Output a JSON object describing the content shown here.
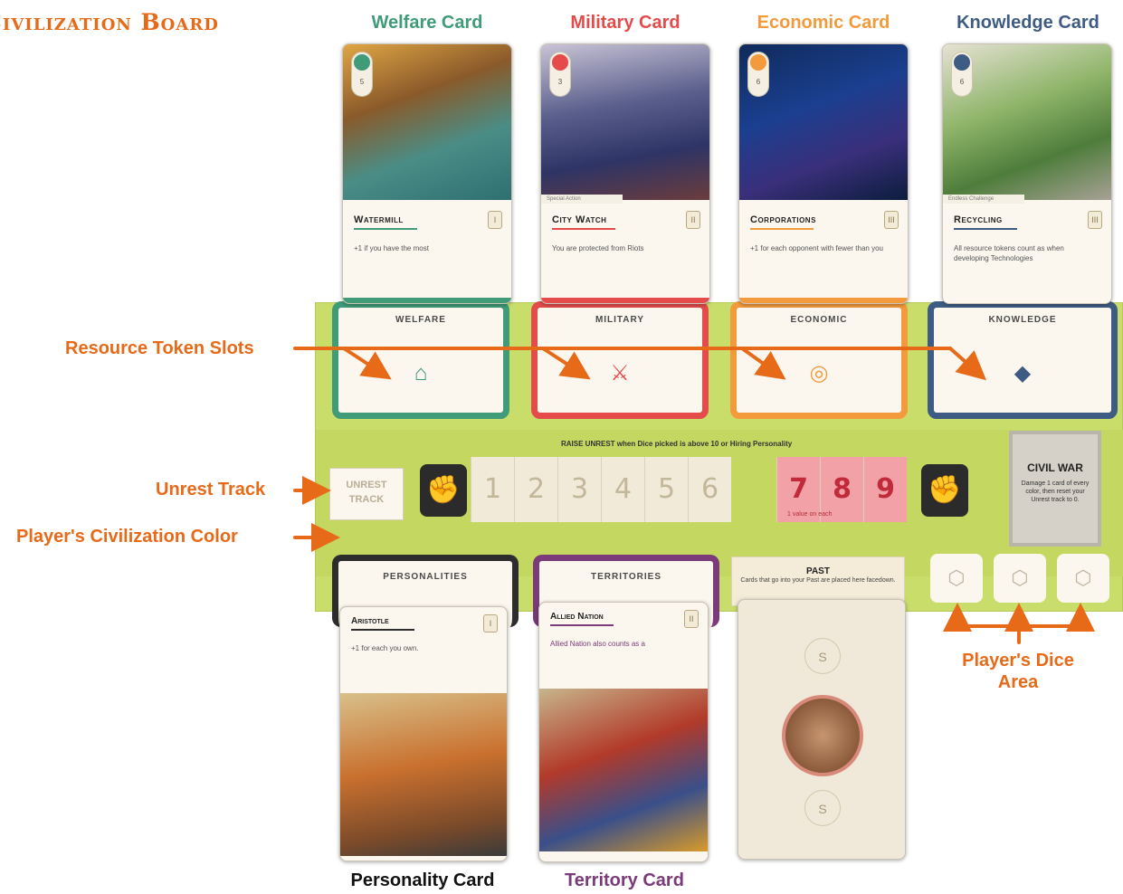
{
  "colors": {
    "welfare": "#3f9b78",
    "military": "#e54b4b",
    "economic": "#f39a3d",
    "knowledge": "#3e5c83",
    "callout": "#e76a19",
    "board": "#c9dd6b",
    "personality": "#2d2d2d",
    "territory": "#7b3a7a"
  },
  "title": "Civilization Board",
  "top_labels": {
    "welfare": "Welfare Card",
    "military": "Military Card",
    "economic": "Economic Card",
    "knowledge": "Knowledge Card"
  },
  "top_cards": [
    {
      "name": "Watermill",
      "roman": "I",
      "cost": "5",
      "text": "+1 if you have the most",
      "icon": "leaf-icon"
    },
    {
      "name": "City Watch",
      "roman": "II",
      "cost": "3",
      "text": "You are protected from Riots",
      "tag": "Special Action",
      "icon": "sword-icon"
    },
    {
      "name": "Corporations",
      "roman": "III",
      "cost": "6",
      "text": "+1 for each opponent with fewer than you",
      "icon": "coins-icon"
    },
    {
      "name": "Recycling",
      "roman": "III",
      "cost": "6",
      "text": "All resource tokens count as when developing Technologies",
      "tag": "Endless Challenge",
      "icon": "book-icon"
    }
  ],
  "board_columns": {
    "welfare": "WELFARE",
    "military": "MILITARY",
    "economic": "ECONOMIC",
    "knowledge": "KNOWLEDGE"
  },
  "raise_unrest": "RAISE UNREST when Dice picked is above 10 or Hiring Personality",
  "unrest_track_label": "UNREST TRACK",
  "track_numbers": [
    "1",
    "2",
    "3",
    "4",
    "5",
    "6",
    "7",
    "8",
    "9"
  ],
  "hot_note": "1 value on each",
  "civil_war": {
    "title": "CIVIL WAR",
    "text": "Damage 1 card of every color, then reset your Unrest track to 0."
  },
  "bottom_columns": {
    "personalities": "PERSONALITIES",
    "territories": "TERRITORIES"
  },
  "past": {
    "title": "PAST",
    "text": "Cards that go into your Past are placed here facedown."
  },
  "bottom_cards": {
    "personality": {
      "name": "Aristotle",
      "roman": "I",
      "text": "+1 for each you own."
    },
    "territory": {
      "name": "Allied Nation",
      "roman": "II",
      "text": "Allied Nation also counts as a"
    }
  },
  "past_card": {
    "coin_top": "S",
    "coin_bottom": "S"
  },
  "callouts": {
    "resource_slots": "Resource Token Slots",
    "unrest": "Unrest Track",
    "civ_color": "Player's Civilization Color",
    "dice": "Player's Dice Area"
  },
  "bottom_labels": {
    "personality": "Personality Card",
    "territory": "Territory Card"
  }
}
